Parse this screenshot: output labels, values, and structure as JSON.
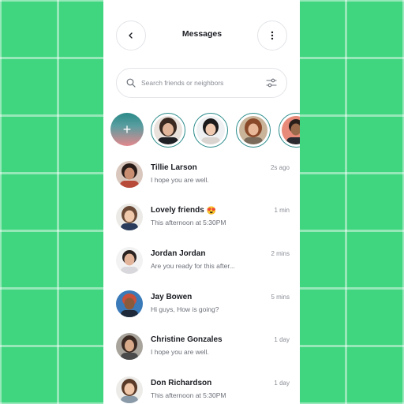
{
  "header": {
    "title": "Messages"
  },
  "search": {
    "placeholder": "Search friends or neighbors"
  },
  "stories": {
    "add_label": "+"
  },
  "chats": [
    {
      "name": "Tillie Larson",
      "preview": "I hope you are well.",
      "time": "2s ago"
    },
    {
      "name": "Lovely friends",
      "preview": "This afternoon at 5:30PM",
      "time": "1 min",
      "emoji": "😍"
    },
    {
      "name": "Jordan Jordan",
      "preview": "Are you ready for this after...",
      "time": "2 mins"
    },
    {
      "name": "Jay Bowen",
      "preview": "Hi guys, How is going?",
      "time": "5 mins"
    },
    {
      "name": "Christine Gonzales",
      "preview": "I hope you are well.",
      "time": "1 day"
    },
    {
      "name": "Don Richardson",
      "preview": "This afternoon at 5:30PM",
      "time": "1 day"
    }
  ],
  "colors": {
    "background": "#3fd67f",
    "accent": "#2a8b8a",
    "card": "#ffffff"
  },
  "icons": [
    "back-icon",
    "more-icon",
    "search-icon",
    "filter-icon",
    "add-icon"
  ]
}
